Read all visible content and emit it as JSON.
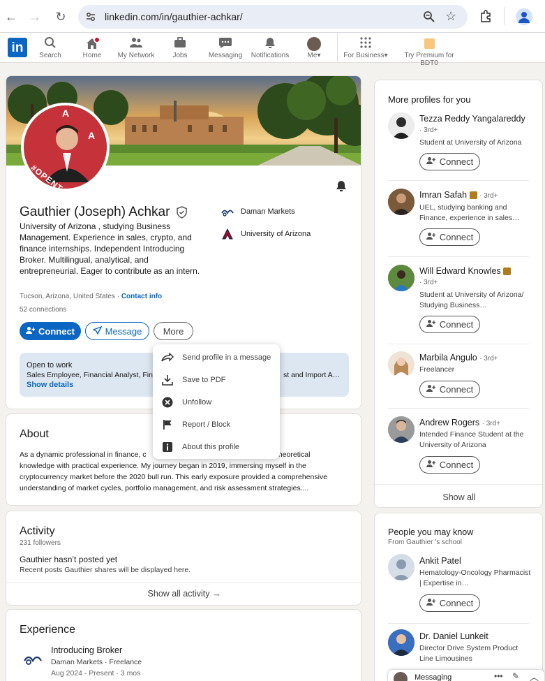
{
  "browser": {
    "url": "linkedin.com/in/gauthier-achkar/"
  },
  "nav": {
    "items": [
      {
        "label": "Search"
      },
      {
        "label": "Home"
      },
      {
        "label": "My Network"
      },
      {
        "label": "Jobs"
      },
      {
        "label": "Messaging"
      },
      {
        "label": "Notifications"
      },
      {
        "label": "Me"
      },
      {
        "label": "For Business"
      },
      {
        "label": "Try Premium for BDT0"
      }
    ]
  },
  "profile": {
    "name": "Gauthier (Joseph) Achkar",
    "headline": "University of Arizona , studying Business Management. Experience in sales, crypto, and finance internships. Independent Introducing Broker. Multilingual, analytical, and entrepreneurial. Eager to contribute as an intern.",
    "location": "Tucson, Arizona, United States",
    "contact_link": "Contact info",
    "connections": "52 connections",
    "badge_text": "#OPENTOWORK",
    "org1": "Daman Markets",
    "org2": "University of Arizona",
    "buttons": {
      "connect": "Connect",
      "message": "Message",
      "more": "More"
    },
    "open_to_work": {
      "title": "Open to work",
      "roles": "Sales Employee, Financial Analyst, Fin",
      "roles_end": "st and Import A…",
      "link": "Show details"
    }
  },
  "dropdown": {
    "items": [
      {
        "label": "Send profile in a message"
      },
      {
        "label": "Save to PDF"
      },
      {
        "label": "Unfollow"
      },
      {
        "label": "Report / Block"
      },
      {
        "label": "About this profile"
      }
    ]
  },
  "about": {
    "title": "About",
    "line1a": "As a dynamic professional in finance, c",
    "line1b": "I blend theoretical",
    "line2a": "knowledge with practical experience. M",
    "line2b": "y journey began in 2019, immersing myself in the",
    "line3": "cryptocurrency market before the 2020 bull run. This early exposure provided a comprehensive",
    "line4": "understanding of market cycles, portfolio management, and risk assessment strategies...."
  },
  "activity": {
    "title": "Activity",
    "followers": "231 followers",
    "empty_title": "Gauthier hasn’t posted yet",
    "empty_sub": "Recent posts Gauthier shares will be displayed here.",
    "show_all": "Show all activity →"
  },
  "experience": {
    "title": "Experience",
    "role": "Introducing Broker",
    "company": "Daman Markets · Freelance",
    "dates": "Aug 2024 - Present · 3 mos"
  },
  "more_profiles": {
    "title": "More profiles for you",
    "people": [
      {
        "name": "Tezza Reddy Yangalareddy",
        "degree": "· 3rd+",
        "desc": "Student at University of Arizona",
        "connect": "Connect"
      },
      {
        "name": "Imran Safah",
        "degree": "· 3rd+",
        "desc": "UEL, studying banking and Finance, experience in sales…",
        "connect": "Connect"
      },
      {
        "name": "Will Edward Knowles",
        "degree": "· 3rd+",
        "desc": "Student at University of Arizona/ Studying Business…",
        "connect": "Connect"
      },
      {
        "name": "Marbila Angulo",
        "degree": "· 3rd+",
        "desc": "Freelancer",
        "connect": "Connect"
      },
      {
        "name": "Andrew Rogers",
        "degree": "· 3rd+",
        "desc": "Intended Finance Student at the University of Arizona",
        "connect": "Connect"
      }
    ],
    "show_all": "Show all"
  },
  "pymk": {
    "title": "People you may know",
    "subtitle": "From Gauthier ’s school",
    "people": [
      {
        "name": "Ankit Patel",
        "desc": "Hematology-Oncology Pharmacist | Expertise in…",
        "connect": "Connect"
      },
      {
        "name": "Dr. Daniel Lunkeit",
        "desc": "Director Drive System Product Line Limousines"
      }
    ]
  },
  "messaging": {
    "label": "Messaging"
  },
  "colors": {
    "accent": "#0a66c2",
    "otw_green": "#3b7a2a",
    "premium_gold": "#f8c77e"
  }
}
